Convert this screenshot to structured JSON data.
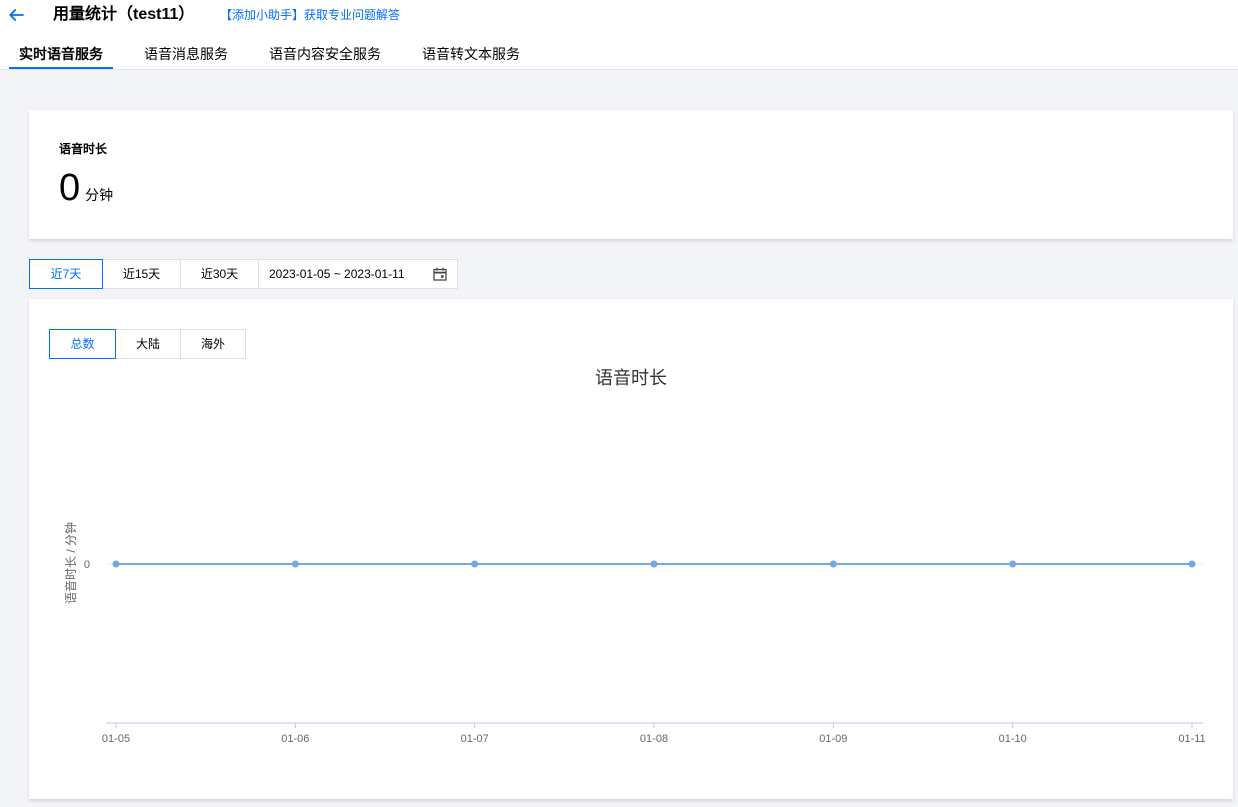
{
  "header": {
    "back_icon": "arrow-left-icon",
    "title": "用量统计（test11）",
    "helper_link": "【添加小助手】获取专业问题解答"
  },
  "tabs": [
    {
      "label": "实时语音服务",
      "active": true
    },
    {
      "label": "语音消息服务",
      "active": false
    },
    {
      "label": "语音内容安全服务",
      "active": false
    },
    {
      "label": "语音转文本服务",
      "active": false
    }
  ],
  "summary": {
    "label": "语音时长",
    "value": "0",
    "unit": "分钟"
  },
  "range_filter": {
    "options": [
      {
        "label": "近7天",
        "active": true
      },
      {
        "label": "近15天",
        "active": false
      },
      {
        "label": "近30天",
        "active": false
      }
    ],
    "date_range": "2023-01-05 ~ 2023-01-11",
    "calendar_icon": "calendar-icon"
  },
  "region_filter": {
    "options": [
      {
        "label": "总数",
        "active": true
      },
      {
        "label": "大陆",
        "active": false
      },
      {
        "label": "海外",
        "active": false
      }
    ]
  },
  "chart_data": {
    "type": "line",
    "title": "语音时长",
    "ylabel": "语音时长 / 分钟",
    "categories": [
      "01-05",
      "01-06",
      "01-07",
      "01-08",
      "01-09",
      "01-10",
      "01-11"
    ],
    "values": [
      0,
      0,
      0,
      0,
      0,
      0,
      0
    ],
    "y_ticks": [
      0
    ],
    "grid": true
  },
  "colors": {
    "accent": "#006eff",
    "series": "#74a8e4",
    "axis": "#b8cde4",
    "gridline": "#e8e8e8",
    "chart_title": "#333333",
    "chart_label": "#666666",
    "page_background": "#f3f4f7"
  }
}
